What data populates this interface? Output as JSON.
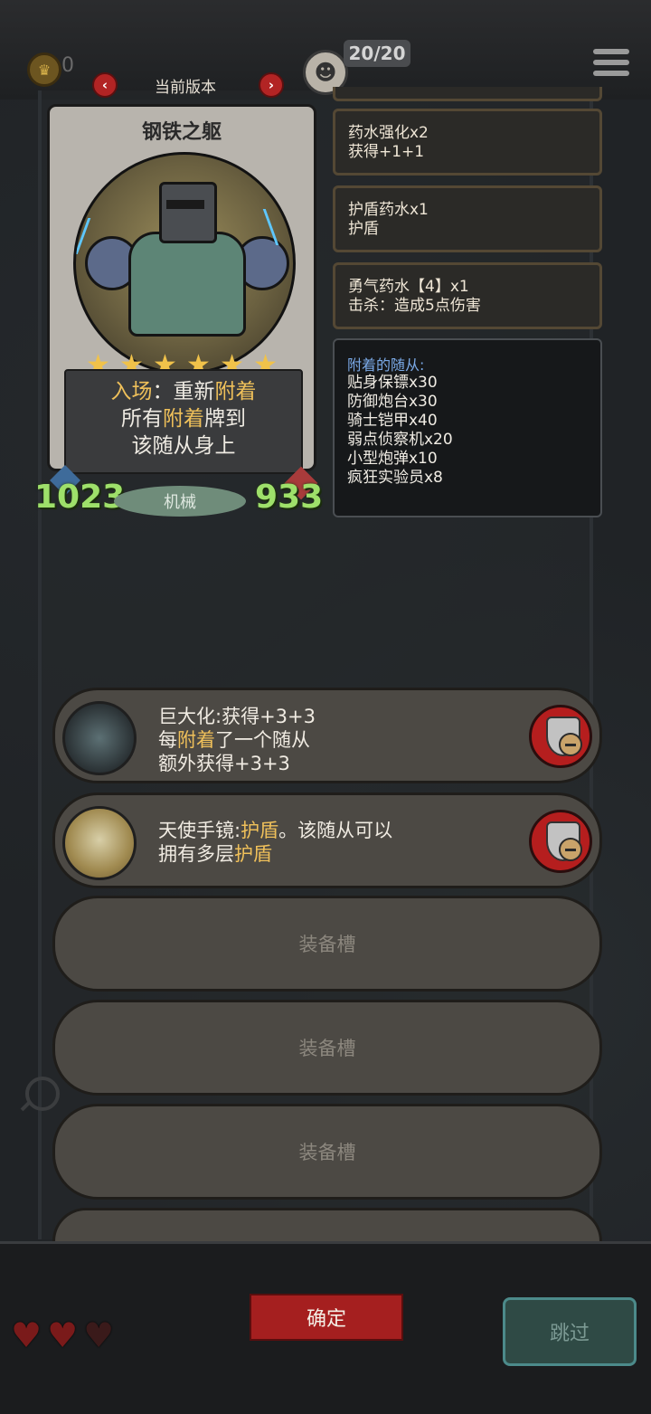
{
  "top_bar": {
    "coins": "0",
    "version_label": "当前版本",
    "prev_arrow": "‹",
    "next_arrow": "›",
    "minion_count": "20/20"
  },
  "card": {
    "name": "钢铁之躯",
    "stars": 6,
    "text_line1_plain": "入场：重新",
    "text_line1_hl": "附着",
    "text_line2_pre": "所有",
    "text_line2_hl": "附着",
    "text_line2_post": "牌到",
    "text_line3": "该随从身上",
    "attack": "1023",
    "tribe": "机械",
    "health": "933"
  },
  "buffs": [
    {
      "name": "药水强化x2",
      "desc": "获得+1+1"
    },
    {
      "name": "护盾药水x1",
      "desc": "护盾"
    },
    {
      "name": "勇气药水【4】x1",
      "desc": "击杀：造成5点伤害"
    }
  ],
  "attached": {
    "header": "附着的随从:",
    "rows": [
      "贴身保镖x30",
      "防御炮台x30",
      "骑士铠甲x40",
      "弱点侦察机x20",
      "小型炮弹x10",
      "疯狂实验员x8"
    ]
  },
  "equipment": [
    {
      "line1": "巨大化:获得+3+3",
      "line2_pre": "每",
      "line2_hl": "附着",
      "line2_post": "了一个随从",
      "line3": "额外获得+3+3"
    },
    {
      "line1_pre": "天使手镜:",
      "line1_hl": "护盾",
      "line1_post": "。该随从可以",
      "line2_pre": "拥有多层",
      "line2_hl": "护盾"
    }
  ],
  "empty_slot_label": "装备槽",
  "confirm_label": "确定",
  "skip_label": "跳过",
  "colors": {
    "highlight": "#efc05a",
    "stat_green": "#9ee06a",
    "confirm_red": "#a51f1f"
  }
}
